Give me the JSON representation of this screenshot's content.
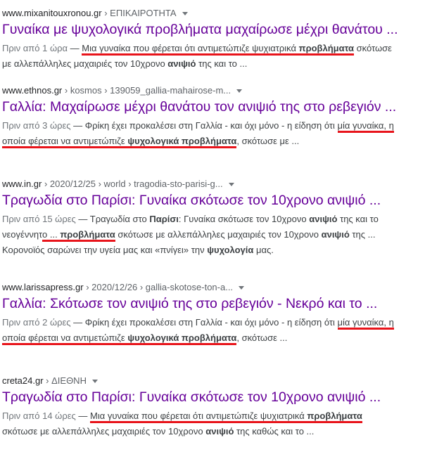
{
  "results": [
    {
      "site": "www.mixanitouxronou.gr",
      "path": " › ΕΠΙΚΑΙΡΟΤΗΤΑ",
      "title": "Γυναίκα με ψυχολογικά προβλήματα μαχαίρωσε μέχρι θανάτου ...",
      "date": "Πριν από 1 ώρα",
      "snippet_lines": [
        [
          {
            "t": "Πριν από 1 ώρα",
            "date": true
          },
          {
            "t": " — "
          },
          {
            "t": "Μια γυναίκα που φέρεται ότι αντιμετώπιζε ψυχιατρικά ",
            "ul": true
          },
          {
            "t": "προβλήματα",
            "b": true,
            "ul": true
          },
          {
            "t": " σκότωσε"
          }
        ],
        [
          {
            "t": "με αλλεπάλληλες μαχαιριές τον 10χρονο "
          },
          {
            "t": "ανιψιό",
            "b": true
          },
          {
            "t": " της και το ..."
          }
        ]
      ]
    },
    {
      "site": "www.ethnos.gr",
      "path": " › kosmos › 139059_gallia-mahairose-m...",
      "title": "Γαλλία: Μαχαίρωσε μέχρι θανάτου τον ανιψιό της στο ρεβεγιόν ...",
      "date": "Πριν από 3 ώρες",
      "snippet_lines": [
        [
          {
            "t": "Πριν από 3 ώρες",
            "date": true
          },
          {
            "t": " — Φρίκη έχει προκαλέσει στη Γαλλία - και όχι μόνο - η είδηση ότι "
          },
          {
            "t": "μία γυναίκα, η",
            "ul": true
          }
        ],
        [
          {
            "t": "οποία φέρεται να αντιμετώπιζε ",
            "ul": true
          },
          {
            "t": "ψυχολογικά προβλήματα",
            "b": true,
            "ul": true
          },
          {
            "t": ", σκότωσε με ..."
          }
        ]
      ]
    },
    {
      "site": "www.in.gr",
      "path": " › 2020/12/25 › world › tragodia-sto-parisi-g...",
      "title": "Τραγωδία στο Παρίσι: Γυναίκα σκότωσε τον 10χρονο ανιψιό ...",
      "date": "Πριν από 15 ώρες",
      "snippet_lines": [
        [
          {
            "t": "Πριν από 15 ώρες",
            "date": true
          },
          {
            "t": " — Τραγωδία στο "
          },
          {
            "t": "Παρίσι",
            "b": true
          },
          {
            "t": ": Γυναίκα σκότωσε τον 10χρονο "
          },
          {
            "t": "ανιψιό",
            "b": true
          },
          {
            "t": " της και το"
          }
        ],
        [
          {
            "t": "νεογέννητ"
          },
          {
            "t": "ο ... ",
            "ul": true
          },
          {
            "t": "προβλήματα",
            "b": true,
            "ul": true
          },
          {
            "t": " σκότωσε με αλλεπάλληλες μαχαιριές τον 10χρονο "
          },
          {
            "t": "ανιψιό",
            "b": true
          },
          {
            "t": " της ..."
          }
        ],
        [
          {
            "t": "Κορονοϊός σαρώνει την υγεία μας και «πνίγει» την "
          },
          {
            "t": "ψυχολογία",
            "b": true
          },
          {
            "t": " μας."
          }
        ]
      ]
    },
    {
      "site": "www.larissapress.gr",
      "path": " › 2020/12/26 › gallia-skotose-ton-a...",
      "title": "Γαλλία: Σκότωσε τον ανιψιό της στο ρεβεγιόν - Νεκρό και το ...",
      "date": "Πριν από 2 ώρες",
      "snippet_lines": [
        [
          {
            "t": "Πριν από 2 ώρες",
            "date": true
          },
          {
            "t": " — Φρίκη έχει προκαλέσει στη Γαλλία - και όχι μόνο - η είδηση ότι "
          },
          {
            "t": "μία γυναίκα, η",
            "ul": true
          }
        ],
        [
          {
            "t": "οποία φέρεται να αντιμετώπιζε ",
            "ul": true
          },
          {
            "t": "ψυχολογικά προβλήματα",
            "b": true,
            "ul": true
          },
          {
            "t": ", σκότωσε ..."
          }
        ]
      ]
    },
    {
      "site": "creta24.gr",
      "path": " › ΔΙΕΘΝΗ",
      "title": "Τραγωδία στο Παρίσι: Γυναίκα σκότωσε τον 10χρονο ανιψιό ...",
      "date": "Πριν από 14 ώρες",
      "snippet_lines": [
        [
          {
            "t": "Πριν από 14 ώρες",
            "date": true
          },
          {
            "t": " — "
          },
          {
            "t": "Μια γυναίκα που φέρεται ότι αντιμετώπιζε ψυχιατρικά ",
            "ul": true
          },
          {
            "t": "προβλήματα",
            "b": true,
            "ul": true
          }
        ],
        [
          {
            "t": "σκότωσε με αλλεπάλληλες μαχαιριές τον 10χρονο "
          },
          {
            "t": "ανιψιό",
            "b": true
          },
          {
            "t": " της καθώς και το ..."
          }
        ]
      ]
    }
  ],
  "colors": {
    "title_visited": "#660099",
    "annotation_underline": "#e8141b",
    "snippet_text": "#3c4043",
    "date_text": "#70757a"
  }
}
